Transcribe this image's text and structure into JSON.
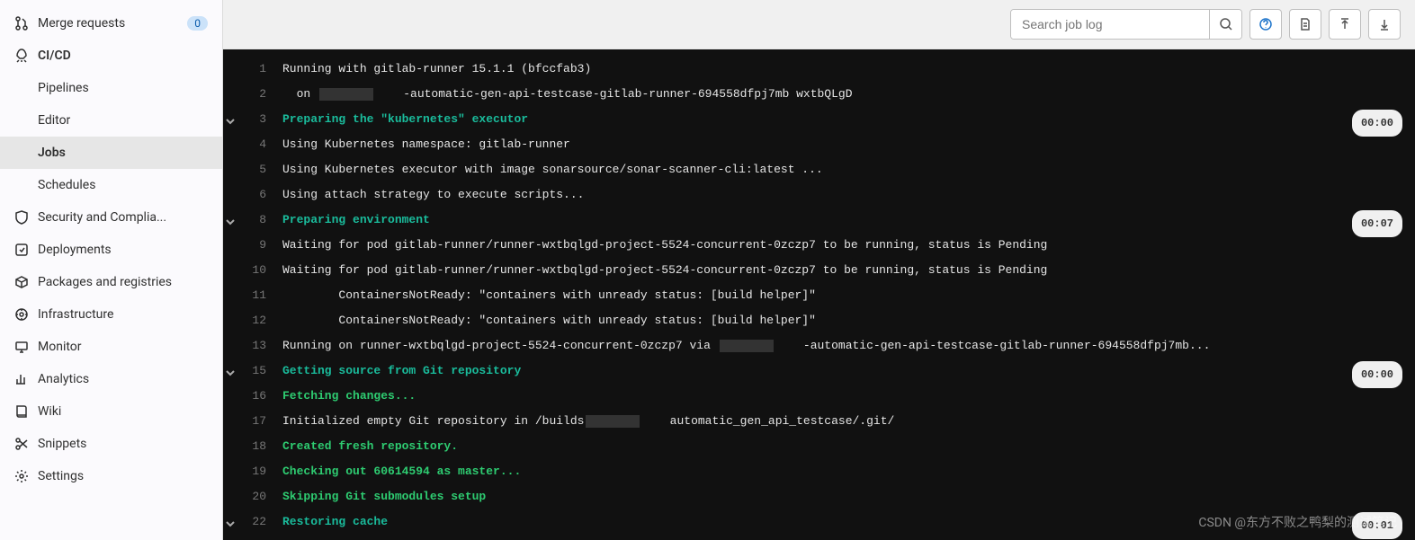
{
  "sidebar": {
    "merge_requests": {
      "label": "Merge requests",
      "badge": "0"
    },
    "cicd": {
      "label": "CI/CD",
      "items": [
        {
          "label": "Pipelines",
          "active": false
        },
        {
          "label": "Editor",
          "active": false
        },
        {
          "label": "Jobs",
          "active": true
        },
        {
          "label": "Schedules",
          "active": false
        }
      ]
    },
    "security": {
      "label": "Security and Complia..."
    },
    "deployments": {
      "label": "Deployments"
    },
    "packages": {
      "label": "Packages and registries"
    },
    "infrastructure": {
      "label": "Infrastructure"
    },
    "monitor": {
      "label": "Monitor"
    },
    "analytics": {
      "label": "Analytics"
    },
    "wiki": {
      "label": "Wiki"
    },
    "snippets": {
      "label": "Snippets"
    },
    "settings": {
      "label": "Settings"
    }
  },
  "toolbar": {
    "search_placeholder": "Search job log"
  },
  "log": {
    "lines": [
      {
        "n": 1,
        "type": "plain",
        "text": "Running with gitlab-runner 15.1.1 (bfccfab3)"
      },
      {
        "n": 2,
        "type": "plain",
        "text": "  on ████    -automatic-gen-api-testcase-gitlab-runner-694558dfpj7mb wxtbQLgD"
      },
      {
        "n": 3,
        "type": "section",
        "text": "Preparing the \"kubernetes\" executor",
        "duration": "00:00",
        "collapsible": true
      },
      {
        "n": 4,
        "type": "plain",
        "text": "Using Kubernetes namespace: gitlab-runner"
      },
      {
        "n": 5,
        "type": "plain",
        "text": "Using Kubernetes executor with image sonarsource/sonar-scanner-cli:latest ..."
      },
      {
        "n": 6,
        "type": "plain",
        "text": "Using attach strategy to execute scripts..."
      },
      {
        "n": 8,
        "type": "section",
        "text": "Preparing environment",
        "duration": "00:07",
        "collapsible": true
      },
      {
        "n": 9,
        "type": "plain",
        "text": "Waiting for pod gitlab-runner/runner-wxtbqlgd-project-5524-concurrent-0zczp7 to be running, status is Pending"
      },
      {
        "n": 10,
        "type": "plain",
        "text": "Waiting for pod gitlab-runner/runner-wxtbqlgd-project-5524-concurrent-0zczp7 to be running, status is Pending"
      },
      {
        "n": 11,
        "type": "plain",
        "text": "        ContainersNotReady: \"containers with unready status: [build helper]\""
      },
      {
        "n": 12,
        "type": "plain",
        "text": "        ContainersNotReady: \"containers with unready status: [build helper]\""
      },
      {
        "n": 13,
        "type": "plain",
        "text": "Running on runner-wxtbqlgd-project-5524-concurrent-0zczp7 via ████    -automatic-gen-api-testcase-gitlab-runner-694558dfpj7mb..."
      },
      {
        "n": 15,
        "type": "section",
        "text": "Getting source from Git repository",
        "duration": "00:00",
        "collapsible": true
      },
      {
        "n": 16,
        "type": "green",
        "text": "Fetching changes..."
      },
      {
        "n": 17,
        "type": "plain",
        "text": "Initialized empty Git repository in /builds████    automatic_gen_api_testcase/.git/"
      },
      {
        "n": 18,
        "type": "green",
        "text": "Created fresh repository."
      },
      {
        "n": 19,
        "type": "green",
        "text": "Checking out 60614594 as master..."
      },
      {
        "n": 20,
        "type": "green",
        "text": "Skipping Git submodules setup"
      },
      {
        "n": 22,
        "type": "section",
        "text": "Restoring cache",
        "duration": "00:01",
        "collapsible": true
      }
    ]
  },
  "watermark": "CSDN @东方不败之鸭梨的测试笔记"
}
